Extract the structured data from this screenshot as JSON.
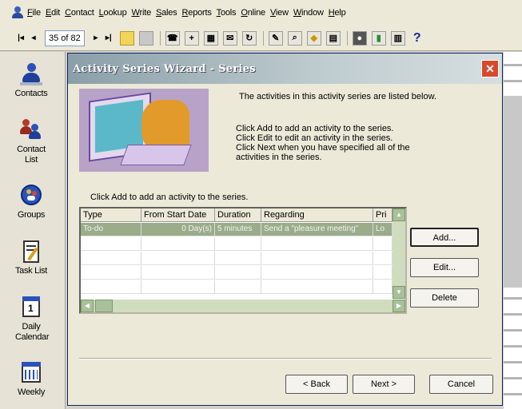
{
  "menu": {
    "items": [
      "File",
      "Edit",
      "Contact",
      "Lookup",
      "Write",
      "Sales",
      "Reports",
      "Tools",
      "Online",
      "View",
      "Window",
      "Help"
    ]
  },
  "toolbar": {
    "record_position": "35 of 82",
    "icons": [
      "first-record",
      "previous-record",
      "next-record",
      "last-record",
      "open-folder",
      "save",
      "phone",
      "new-contact",
      "schedule",
      "email",
      "history",
      "note",
      "lookup",
      "tag",
      "report",
      "globe",
      "attach",
      "calendar",
      "help"
    ]
  },
  "sidebar": {
    "items": [
      {
        "label": "Contacts",
        "icon": "person-icon"
      },
      {
        "label": "Contact List",
        "icon": "people-icon"
      },
      {
        "label": "Groups",
        "icon": "groups-icon"
      },
      {
        "label": "Task List",
        "icon": "task-list-icon"
      },
      {
        "label": "Daily Calendar",
        "icon": "daily-calendar-icon"
      },
      {
        "label": "Weekly",
        "icon": "weekly-calendar-icon"
      }
    ]
  },
  "dialog": {
    "title": "Activity Series Wizard - Series",
    "intro": "The activities in this activity series are listed below.",
    "instructions": [
      "Click Add to add an activity to the series.",
      "Click Edit to edit an activity in the series.",
      "Click Next when you have specified all of the",
      "activities in the series."
    ],
    "table_label": "Click Add to add an activity to the series.",
    "table": {
      "columns": [
        "Type",
        "From Start Date",
        "Duration",
        "Regarding",
        "Pri"
      ],
      "rows": [
        [
          "To-do",
          "0 Day(s)",
          "5 minutes",
          "Send a \"pleasure meeting\"",
          "Lo"
        ]
      ]
    },
    "buttons": {
      "add": "Add...",
      "edit": "Edit...",
      "delete": "Delete",
      "back": "< Back",
      "next": "Next >",
      "cancel": "Cancel"
    }
  },
  "colors": {
    "title_gradient_start": "#8a9fa8",
    "close_button": "#d9482c",
    "selected_row": "#9aac8a"
  }
}
